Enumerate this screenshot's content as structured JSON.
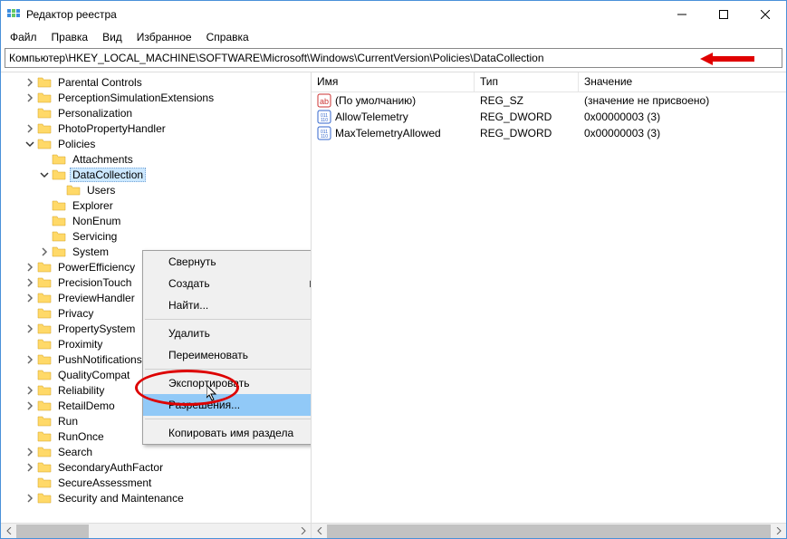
{
  "window": {
    "title": "Редактор реестра"
  },
  "menu": {
    "file": "Файл",
    "edit": "Правка",
    "view": "Вид",
    "favorites": "Избранное",
    "help": "Справка"
  },
  "address": {
    "path": "Компьютер\\HKEY_LOCAL_MACHINE\\SOFTWARE\\Microsoft\\Windows\\CurrentVersion\\Policies\\DataCollection"
  },
  "columns": {
    "name": "Имя",
    "type": "Тип",
    "value": "Значение"
  },
  "values": [
    {
      "name": "(По умолчанию)",
      "type": "REG_SZ",
      "data": "(значение не присвоено)",
      "icon": "sz"
    },
    {
      "name": "AllowTelemetry",
      "type": "REG_DWORD",
      "data": "0x00000003 (3)",
      "icon": "dw"
    },
    {
      "name": "MaxTelemetryAllowed",
      "type": "REG_DWORD",
      "data": "0x00000003 (3)",
      "icon": "dw"
    }
  ],
  "tree": [
    {
      "indent": 1,
      "exp": ">",
      "label": "Parental Controls"
    },
    {
      "indent": 1,
      "exp": ">",
      "label": "PerceptionSimulationExtensions"
    },
    {
      "indent": 1,
      "exp": "",
      "label": "Personalization"
    },
    {
      "indent": 1,
      "exp": ">",
      "label": "PhotoPropertyHandler"
    },
    {
      "indent": 1,
      "exp": "v",
      "label": "Policies"
    },
    {
      "indent": 2,
      "exp": "",
      "label": "Attachments"
    },
    {
      "indent": 2,
      "exp": "v",
      "label": "DataCollection",
      "selected": true
    },
    {
      "indent": 3,
      "exp": "",
      "label": "Users"
    },
    {
      "indent": 2,
      "exp": "",
      "label": "Explorer"
    },
    {
      "indent": 2,
      "exp": "",
      "label": "NonEnum"
    },
    {
      "indent": 2,
      "exp": "",
      "label": "Servicing"
    },
    {
      "indent": 2,
      "exp": ">",
      "label": "System"
    },
    {
      "indent": 1,
      "exp": ">",
      "label": "PowerEfficiency"
    },
    {
      "indent": 1,
      "exp": ">",
      "label": "PrecisionTouch"
    },
    {
      "indent": 1,
      "exp": ">",
      "label": "PreviewHandler"
    },
    {
      "indent": 1,
      "exp": "",
      "label": "Privacy"
    },
    {
      "indent": 1,
      "exp": ">",
      "label": "PropertySystem"
    },
    {
      "indent": 1,
      "exp": "",
      "label": "Proximity"
    },
    {
      "indent": 1,
      "exp": ">",
      "label": "PushNotifications"
    },
    {
      "indent": 1,
      "exp": "",
      "label": "QualityCompat"
    },
    {
      "indent": 1,
      "exp": ">",
      "label": "Reliability"
    },
    {
      "indent": 1,
      "exp": ">",
      "label": "RetailDemo"
    },
    {
      "indent": 1,
      "exp": "",
      "label": "Run"
    },
    {
      "indent": 1,
      "exp": "",
      "label": "RunOnce"
    },
    {
      "indent": 1,
      "exp": ">",
      "label": "Search"
    },
    {
      "indent": 1,
      "exp": ">",
      "label": "SecondaryAuthFactor"
    },
    {
      "indent": 1,
      "exp": "",
      "label": "SecureAssessment"
    },
    {
      "indent": 1,
      "exp": ">",
      "label": "Security and Maintenance"
    }
  ],
  "context_menu": [
    {
      "label": "Свернуть",
      "type": "item"
    },
    {
      "label": "Создать",
      "type": "item",
      "submenu": true
    },
    {
      "label": "Найти...",
      "type": "item"
    },
    {
      "type": "sep"
    },
    {
      "label": "Удалить",
      "type": "item"
    },
    {
      "label": "Переименовать",
      "type": "item"
    },
    {
      "type": "sep"
    },
    {
      "label": "Экспортировать",
      "type": "item"
    },
    {
      "label": "Разрешения...",
      "type": "item",
      "highlighted": true
    },
    {
      "type": "sep"
    },
    {
      "label": "Копировать имя раздела",
      "type": "item"
    }
  ]
}
